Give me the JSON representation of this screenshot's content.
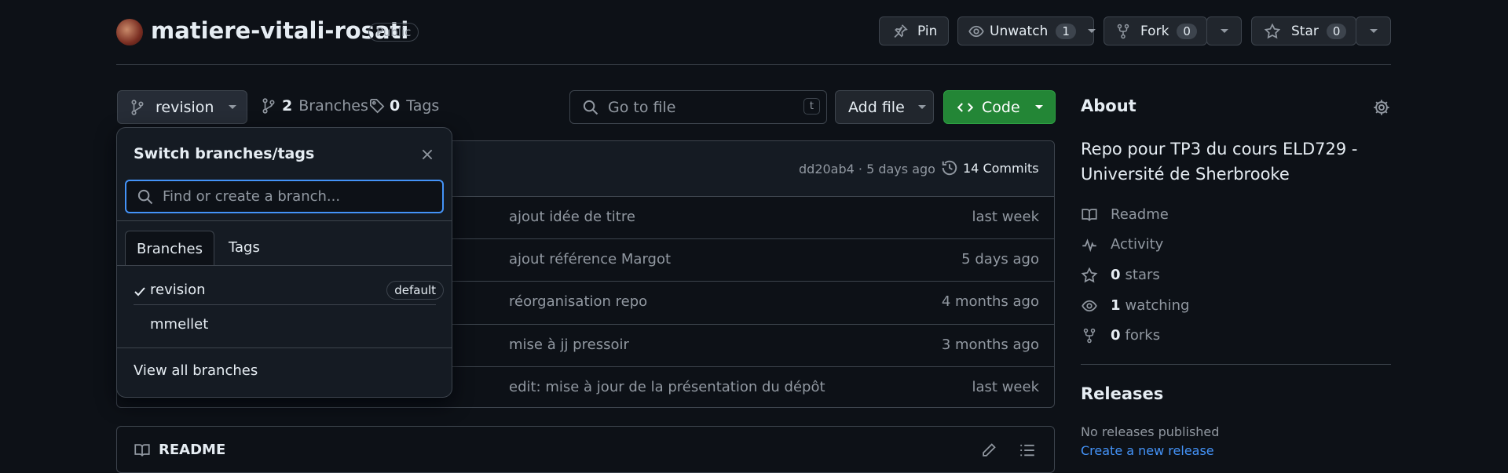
{
  "repo": {
    "name": "matiere-vitali-rosati",
    "visibility": "Public"
  },
  "header_actions": {
    "pin_label": "Pin",
    "unwatch_label": "Unwatch",
    "unwatch_count": "1",
    "fork_label": "Fork",
    "fork_count": "0",
    "star_label": "Star",
    "star_count": "0"
  },
  "toolbar": {
    "branch_name": "revision",
    "branches_count": "2",
    "branches_label": "Branches",
    "tags_count": "0",
    "tags_label": "Tags",
    "go_to_file_placeholder": "Go to file",
    "go_to_file_shortcut": "t",
    "add_file_label": "Add file",
    "code_label": "Code"
  },
  "commit_header": {
    "hash_time": "dd20ab4 · 5 days ago",
    "commits_label": "14 Commits"
  },
  "file_rows": [
    {
      "message": "ajout idée de titre",
      "date": "last week"
    },
    {
      "message": "ajout référence Margot",
      "date": "5 days ago"
    },
    {
      "message": "réorganisation repo",
      "date": "4 months ago"
    },
    {
      "message": "mise à jj pressoir",
      "date": "3 months ago"
    },
    {
      "message": "edit: mise à jour de la présentation du dépôt",
      "date": "last week"
    }
  ],
  "readme_header": "README",
  "branch_popup": {
    "title": "Switch branches/tags",
    "search_placeholder": "Find or create a branch...",
    "tabs": [
      "Branches",
      "Tags"
    ],
    "branches": [
      {
        "name": "revision",
        "badge": "default",
        "selected": true
      },
      {
        "name": "mmellet",
        "badge": "",
        "selected": false
      }
    ],
    "view_all_label": "View all branches"
  },
  "about": {
    "title": "About",
    "description": "Repo pour TP3 du cours ELD729 - Université de Sherbrooke",
    "readme_label": "Readme",
    "activity_label": "Activity",
    "stars_count": "0",
    "stars_label": "stars",
    "watching_count": "1",
    "watching_label": "watching",
    "forks_count": "0",
    "forks_label": "forks"
  },
  "releases": {
    "title": "Releases",
    "none_text": "No releases published",
    "create_link": "Create a new release"
  },
  "colors": {
    "background": "#0d1117",
    "green_button": "#238636",
    "accent_blue": "#4493f8"
  }
}
